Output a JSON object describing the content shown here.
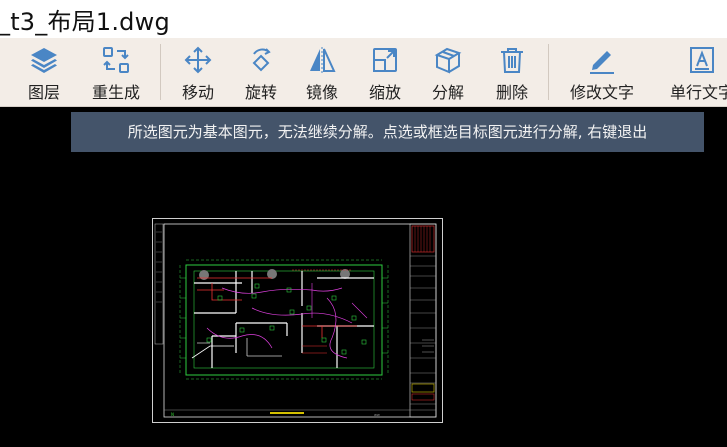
{
  "window": {
    "title": "_t3_布局1.dwg"
  },
  "toolbar": {
    "items": [
      {
        "label": "图层",
        "icon": "layers-icon"
      },
      {
        "label": "重生成",
        "icon": "regenerate-icon"
      },
      {
        "label": "移动",
        "icon": "move-icon"
      },
      {
        "label": "旋转",
        "icon": "rotate-icon"
      },
      {
        "label": "镜像",
        "icon": "mirror-icon"
      },
      {
        "label": "缩放",
        "icon": "scale-icon"
      },
      {
        "label": "分解",
        "icon": "explode-icon"
      },
      {
        "label": "删除",
        "icon": "delete-icon"
      },
      {
        "label": "修改文字",
        "icon": "edit-text-icon"
      },
      {
        "label": "单行文字",
        "icon": "single-line-text-icon"
      }
    ]
  },
  "status": {
    "tooltip": "所选图元为基本图元，无法继续分解。点选或框选目标图元进行分解, 右键退出"
  },
  "colors": {
    "toolbar_bg": "#f3ede7",
    "icon_blue": "#4a86c5",
    "canvas_bg": "#000000",
    "tooltip_bg": "#44546a"
  }
}
